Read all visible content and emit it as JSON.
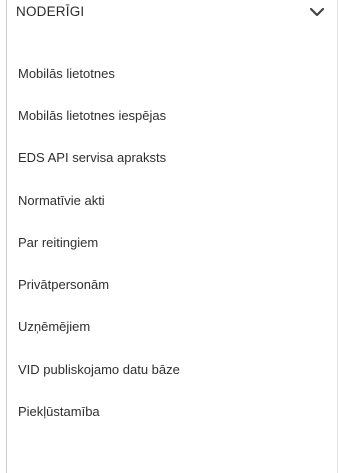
{
  "dropdown": {
    "title": "NODERĪGI",
    "icon": "chevron-down-icon"
  },
  "menu": {
    "items": [
      {
        "label": "Mobilās lietotnes"
      },
      {
        "label": "Mobilās lietotnes iespējas"
      },
      {
        "label": "EDS API servisa apraksts"
      },
      {
        "label": "Normatīvie akti"
      },
      {
        "label": "Par reitingiem"
      },
      {
        "label": "Privātpersonām"
      },
      {
        "label": "Uzņēmējiem"
      },
      {
        "label": "VID publiskojamo datu bāze"
      },
      {
        "label": "Piekļūstamība"
      }
    ]
  }
}
